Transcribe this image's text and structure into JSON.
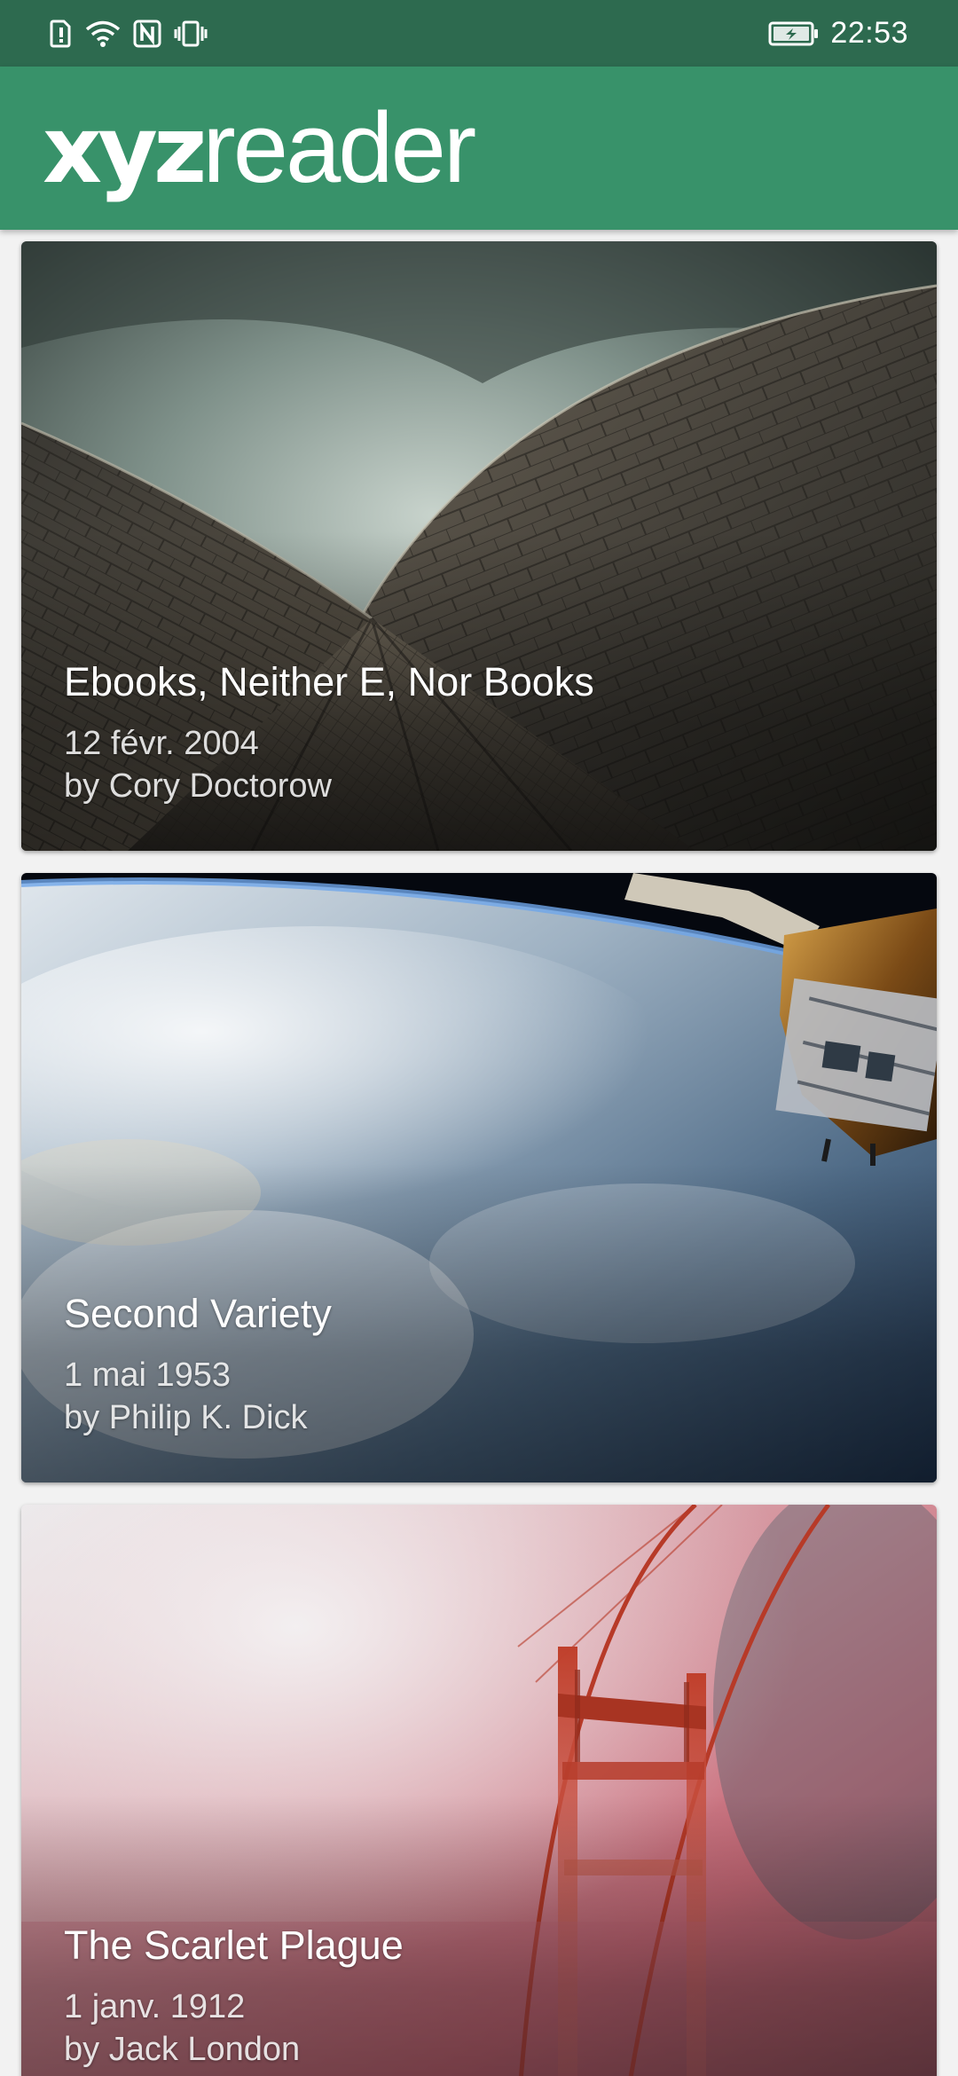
{
  "status_bar": {
    "time": "22:53",
    "icons": [
      "alert-sim-icon",
      "wifi-icon",
      "nfc-icon",
      "vibrate-icon",
      "battery-charging-icon"
    ]
  },
  "app_bar": {
    "logo_bold": "xyz",
    "logo_light": "reader",
    "background": "#38926a",
    "status_background": "#2d6a4f"
  },
  "articles": [
    {
      "title": "Ebooks, Neither E, Nor Books",
      "date": "12 févr. 2004",
      "author": "by Cory Doctorow",
      "image": "opera-house-roof-shells"
    },
    {
      "title": "Second Variety",
      "date": "1 mai 1953",
      "author": "by Philip K. Dick",
      "image": "earth-from-space-station"
    },
    {
      "title": "The Scarlet Plague",
      "date": "1 janv. 1912",
      "author": "by Jack London",
      "image": "bridge-tower-in-red-fog"
    }
  ]
}
